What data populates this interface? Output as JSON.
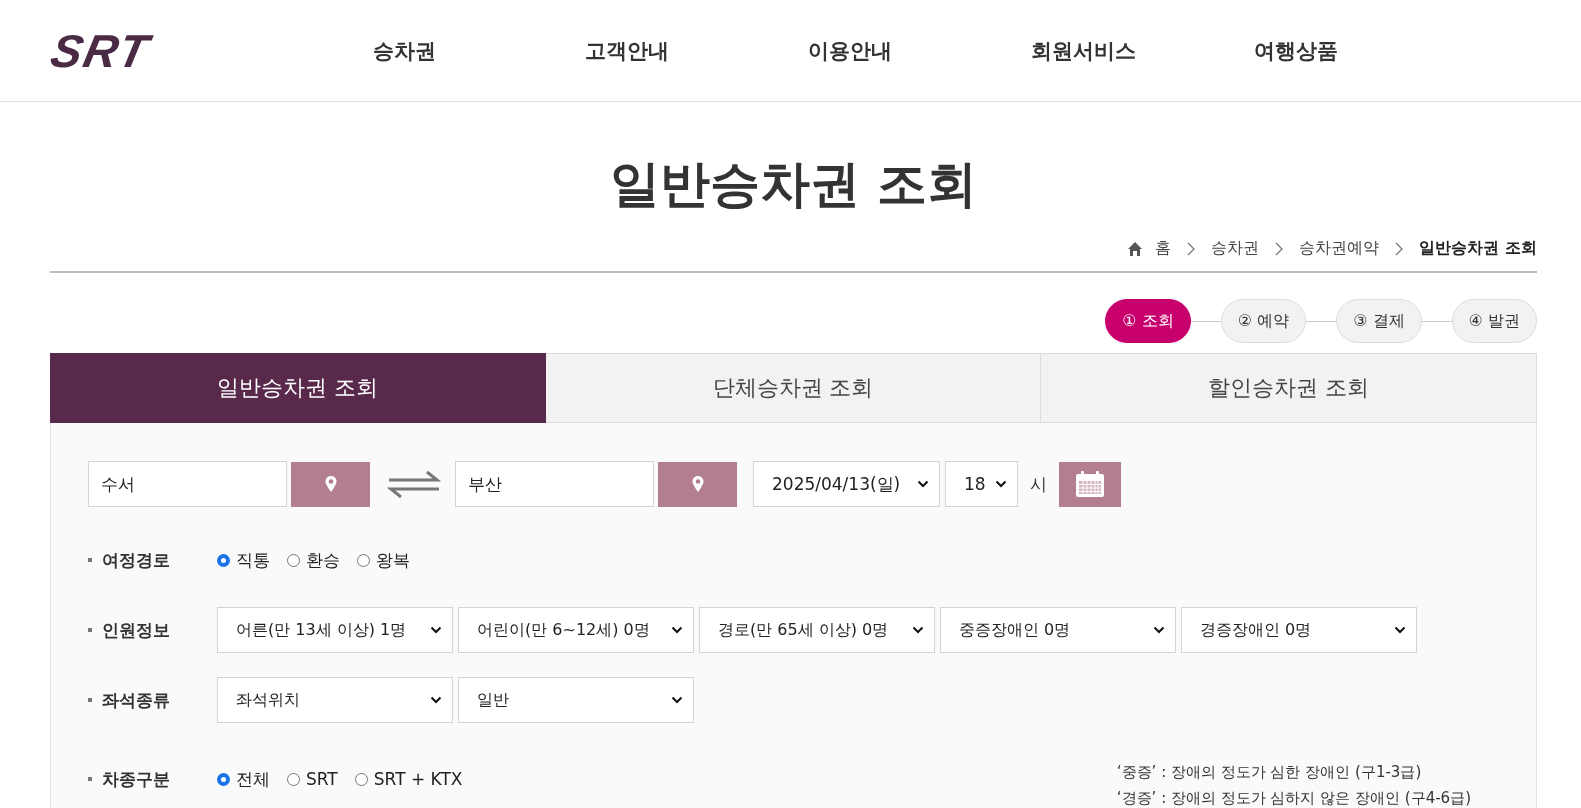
{
  "header": {
    "logo": "SRT",
    "nav": [
      "승차권",
      "고객안내",
      "이용안내",
      "회원서비스",
      "여행상품"
    ]
  },
  "page_title": "일반승차권 조회",
  "breadcrumb": [
    "홈",
    "승차권",
    "승차권예약",
    "일반승차권 조회"
  ],
  "steps": [
    {
      "label": "① 조회",
      "selected": true
    },
    {
      "label": "② 예약",
      "selected": false
    },
    {
      "label": "③ 결제",
      "selected": false
    },
    {
      "label": "④ 발권",
      "selected": false
    }
  ],
  "tabs": [
    {
      "label": "일반승차권 조회",
      "selected": true
    },
    {
      "label": "단체승차권 조회",
      "selected": false
    },
    {
      "label": "할인승차권 조회",
      "selected": false
    }
  ],
  "search": {
    "departure": "수서",
    "arrival": "부산",
    "date": "2025/04/13(일)",
    "hour": "18",
    "hour_unit": "시"
  },
  "rows": [
    {
      "kind": "radio",
      "label": "여정경로",
      "options": [
        {
          "label": "직통",
          "selected": true
        },
        {
          "label": "환승",
          "selected": false
        },
        {
          "label": "왕복",
          "selected": false
        }
      ]
    },
    {
      "kind": "select",
      "label": "인원정보",
      "selects": [
        "어른(만 13세 이상) 1명",
        "어린이(만 6~12세) 0명",
        "경로(만 65세 이상) 0명",
        "중증장애인 0명",
        "경증장애인 0명"
      ]
    },
    {
      "kind": "select",
      "label": "좌석종류",
      "selects": [
        "좌석위치",
        "일반"
      ]
    },
    {
      "kind": "radio",
      "label": "차종구분",
      "options": [
        {
          "label": "전체",
          "selected": true
        },
        {
          "label": "SRT",
          "selected": false
        },
        {
          "label": "SRT + KTX",
          "selected": false
        }
      ],
      "notes": [
        "‘중증’ : 장애의 정도가 심한 장애인 (구1-3급)",
        "‘경증’ : 장애의 정도가 심하지 않은 장애인 (구4-6급)"
      ]
    }
  ]
}
